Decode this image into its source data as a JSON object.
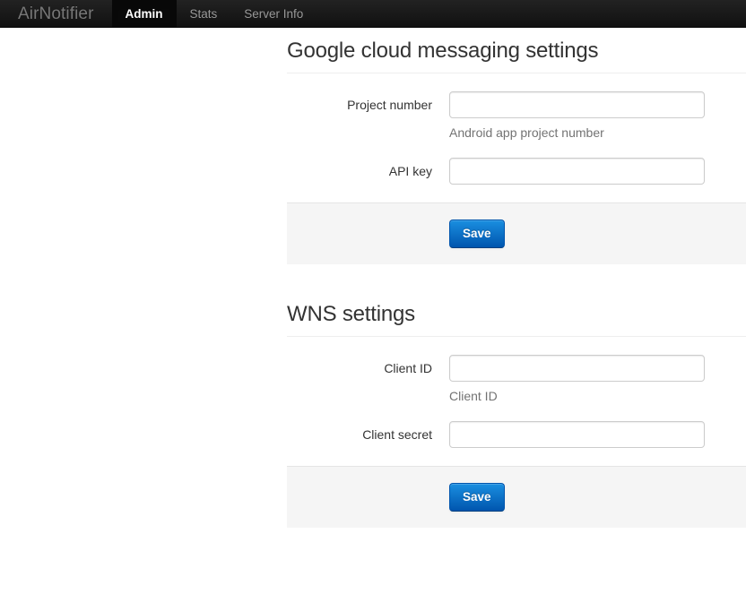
{
  "navbar": {
    "brand": "AirNotifier",
    "items": [
      {
        "label": "Admin",
        "active": true
      },
      {
        "label": "Stats",
        "active": false
      },
      {
        "label": "Server Info",
        "active": false
      }
    ]
  },
  "sections": [
    {
      "title": "Google cloud messaging settings",
      "fields": [
        {
          "label": "Project number",
          "value": "",
          "placeholder": "",
          "help": "Android app project number"
        },
        {
          "label": "API key",
          "value": "",
          "placeholder": "",
          "help": ""
        }
      ],
      "save_label": "Save"
    },
    {
      "title": "WNS settings",
      "fields": [
        {
          "label": "Client ID",
          "value": "",
          "placeholder": "",
          "help": "Client ID"
        },
        {
          "label": "Client secret",
          "value": "",
          "placeholder": "",
          "help": ""
        }
      ],
      "save_label": "Save"
    }
  ],
  "colors": {
    "navbar_top": "#222222",
    "navbar_bottom": "#111111",
    "brand_text": "#777777",
    "nav_link": "#999999",
    "nav_link_active": "#ffffff",
    "heading": "#333333",
    "help_text": "#737373",
    "input_border": "#cccccc",
    "actions_background": "#f5f5f5",
    "button_primary": "#0064cd"
  }
}
